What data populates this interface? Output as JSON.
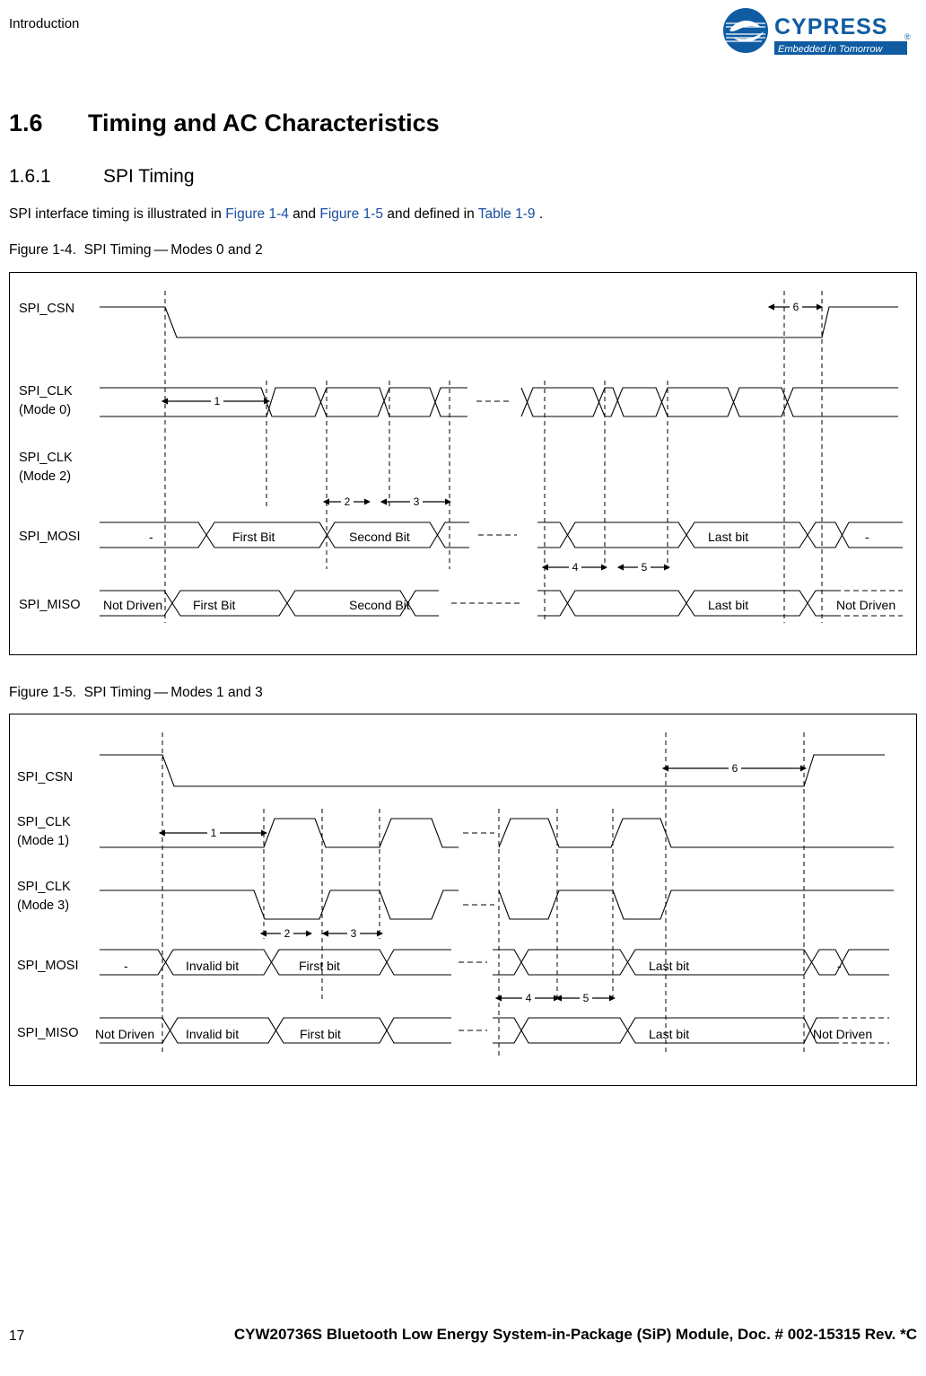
{
  "header": {
    "running_head": "Introduction",
    "logo_name": "Cypress",
    "logo_tagline": "Embedded in Tomorrow™"
  },
  "section": {
    "number": "1.6",
    "title": "Timing and AC Characteristics",
    "sub_number": "1.6.1",
    "sub_title": "SPI Timing"
  },
  "body": {
    "paragraph_pre": "SPI interface timing is illustrated in ",
    "ref1": "Figure 1-4",
    "paragraph_mid1": " and ",
    "ref2": "Figure 1-5",
    "paragraph_mid2": " and defined in ",
    "ref3": "Table 1-9",
    "paragraph_post": " ."
  },
  "figures": [
    {
      "caption_label": "Figure 1-4.",
      "caption_text": "SPI Timing — Modes 0 and 2",
      "signals": [
        {
          "name": "SPI_CSN",
          "mode": ""
        },
        {
          "name": "SPI_CLK",
          "mode": "(Mode 0)"
        },
        {
          "name": "SPI_CLK",
          "mode": "(Mode 2)"
        },
        {
          "name": "SPI_MOSI",
          "mode": ""
        },
        {
          "name": "SPI_MISO",
          "mode": ""
        }
      ],
      "mosi_cells": [
        "-",
        "First Bit",
        "Second Bit",
        "Last bit",
        "-"
      ],
      "miso_cells": [
        "Not Driven",
        "First Bit",
        "Second Bit",
        "Last bit",
        "Not Driven"
      ],
      "markers": [
        "1",
        "2",
        "3",
        "4",
        "5",
        "6"
      ]
    },
    {
      "caption_label": "Figure 1-5.",
      "caption_text": "SPI Timing — Modes 1 and 3",
      "signals": [
        {
          "name": "SPI_CSN",
          "mode": ""
        },
        {
          "name": "SPI_CLK",
          "mode": "(Mode 1)"
        },
        {
          "name": "SPI_CLK",
          "mode": "(Mode 3)"
        },
        {
          "name": "SPI_MOSI",
          "mode": ""
        },
        {
          "name": "SPI_MISO",
          "mode": ""
        }
      ],
      "mosi_cells": [
        "-",
        "Invalid bit",
        "First bit",
        "Last bit",
        "-"
      ],
      "miso_cells": [
        "Not Driven",
        "Invalid bit",
        "First bit",
        "Last bit",
        "Not Driven"
      ],
      "markers": [
        "1",
        "2",
        "3",
        "4",
        "5",
        "6"
      ]
    }
  ],
  "footer": {
    "page_number": "17",
    "text": "CYW20736S Bluetooth Low Energy System-in-Package (SiP) Module, Doc. # 002-15315 Rev. *C"
  },
  "colors": {
    "link": "#1a4fa0",
    "logo_blue": "#0f5ca3",
    "line": "#000000"
  }
}
